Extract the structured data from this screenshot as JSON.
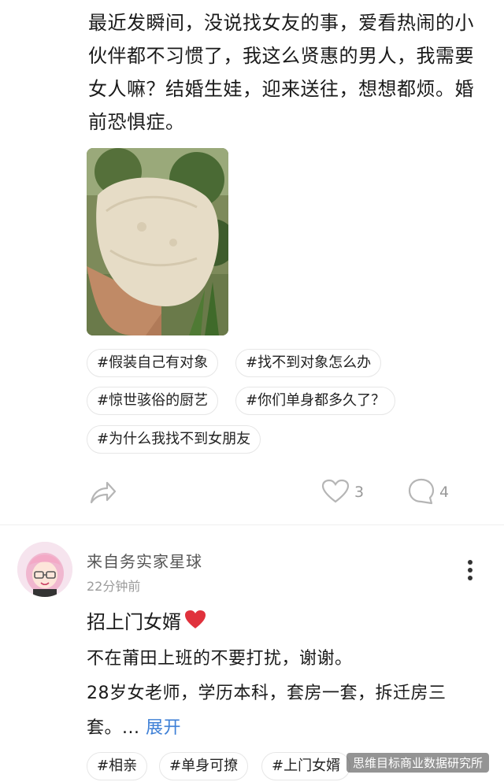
{
  "post": {
    "text": "最近发瞬间，没说找女友的事，爱看热闹的小伙伴都不习惯了，我这么贤惠的男人，我需要女人嘛？结婚生娃，迎来送往，想想都烦。婚前恐惧症。",
    "tags": [
      "#假装自己有对象",
      "#找不到对象怎么办",
      "#惊世骇俗的厨艺",
      "#你们单身都多久了？",
      "#为什么我找不到女朋友"
    ],
    "like_count": "3",
    "comment_count": "4"
  },
  "comment": {
    "username": "来自务实家星球",
    "time": "22分钟前",
    "title": "招上门女婿",
    "line1": "不在莆田上班的不要打扰，谢谢。",
    "line2": "28岁女老师，学历本科，套房一套，拆迁房三",
    "line3": "套。...",
    "expand": "展开",
    "tags": [
      "#相亲",
      "#单身可撩",
      "#上门女婿"
    ]
  },
  "watermark": "思维目标商业数据研究所",
  "colors": {
    "link": "#3d7fd6",
    "muted": "#9b9b9b"
  },
  "icons": [
    "share-icon",
    "heart-icon",
    "comment-icon",
    "more-icon"
  ]
}
